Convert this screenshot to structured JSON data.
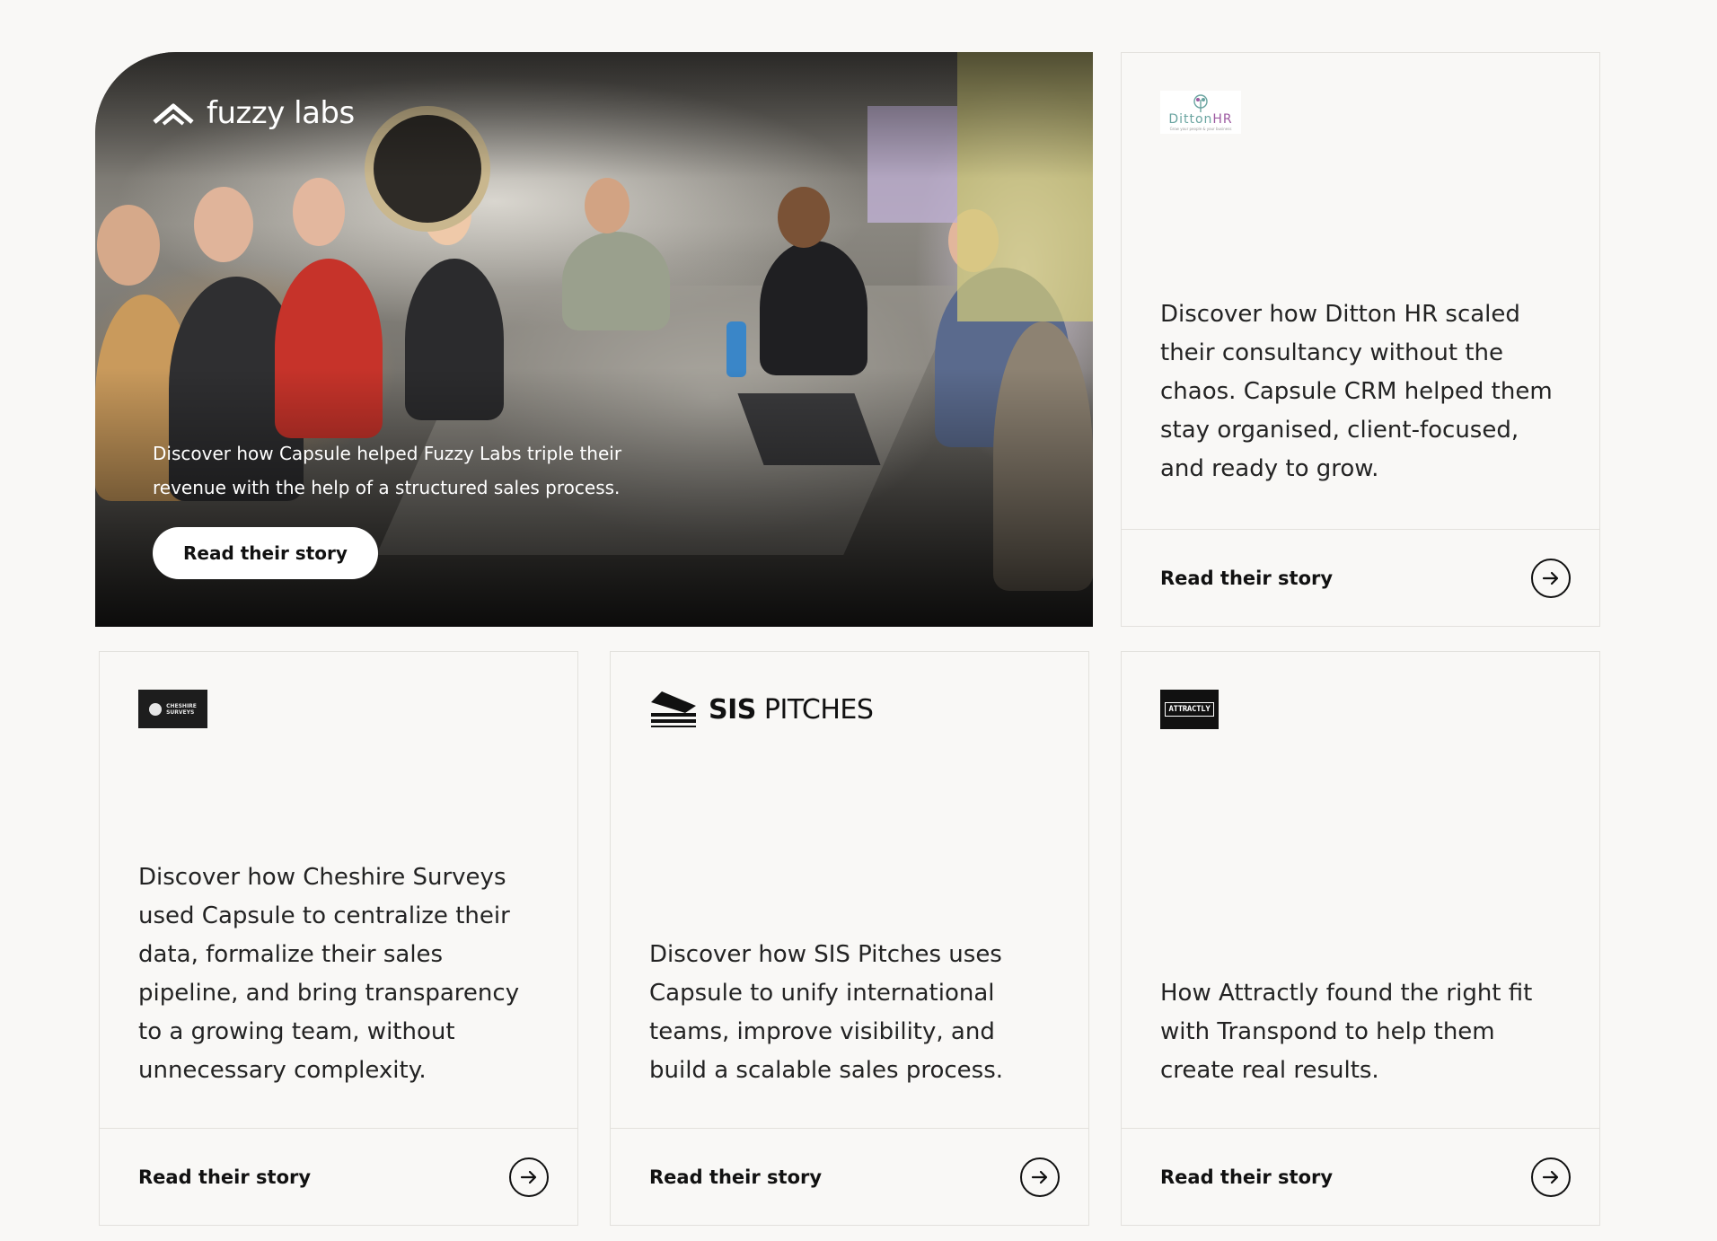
{
  "featured": {
    "logo_text": "fuzzy labs",
    "description": "Discover how Capsule helped Fuzzy Labs triple their revenue with the help of a structured sales process.",
    "cta_label": "Read their story"
  },
  "cards": {
    "ditton": {
      "logo_word_a": "Ditton",
      "logo_word_b": "HR",
      "logo_tag": "Grow your people & your business",
      "description": "Discover how Ditton HR scaled their consultancy without the chaos. Capsule CRM helped them stay organised, client-focused, and ready to grow.",
      "cta_label": "Read their story"
    },
    "cheshire": {
      "logo_line1": "CHESHIRE",
      "logo_line2": "SURVEYS",
      "description": "Discover how Cheshire Surveys used Capsule to centralize their data, formalize their sales pipeline, and bring transparency to a growing team, without unnecessary complexity.",
      "cta_label": "Read their story"
    },
    "sis": {
      "logo_bold": "SIS",
      "logo_rest": " PITCHES",
      "description": "Discover how SIS Pitches uses Capsule to unify international teams, improve visibility, and build a scalable sales process.",
      "cta_label": "Read their story"
    },
    "attractly": {
      "logo_text": "ATTRACTLY",
      "description": "How Attractly found the right fit with Transpond to help them create real results.",
      "cta_label": "Read their story"
    }
  },
  "icons": {
    "arrow": "arrow-right-circle-icon",
    "fuzzy": "chevron-up-logo-icon",
    "sis": "stacked-layers-logo-icon"
  }
}
